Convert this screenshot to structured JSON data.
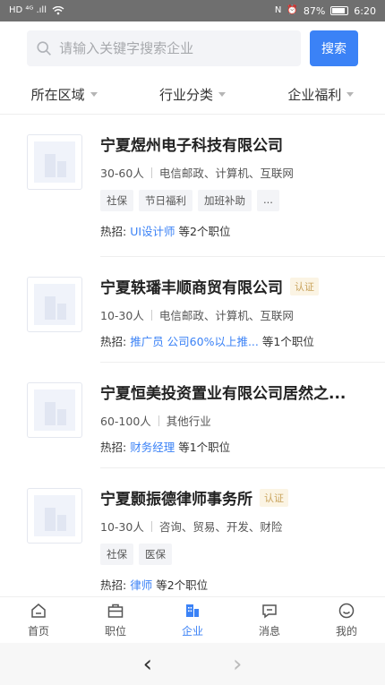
{
  "status_bar": {
    "left": "HD ⁴ᴳ .ıll",
    "nfc": "N",
    "alarm": "⏰",
    "battery": "87%",
    "time": "6:20"
  },
  "search": {
    "placeholder": "请输入关键字搜索企业",
    "button": "搜索"
  },
  "filters": [
    "所在区域",
    "行业分类",
    "企业福利"
  ],
  "companies": [
    {
      "name": "宁夏煜州电子科技有限公司",
      "verified": "",
      "size": "30-60人",
      "industry": "电信邮政、计算机、互联网",
      "tags": [
        "社保",
        "节日福利",
        "加班补助",
        "..."
      ],
      "hot_label": "热招:",
      "hot_job": "UI设计师",
      "hot_count": "等2个职位"
    },
    {
      "name": "宁夏轶璠丰顺商贸有限公司",
      "verified": "认证",
      "size": "10-30人",
      "industry": "电信邮政、计算机、互联网",
      "tags": [],
      "hot_label": "热招:",
      "hot_job": "推广员 公司60%以上推...",
      "hot_count": "等1个职位"
    },
    {
      "name": "宁夏恒美投资置业有限公司居然之...",
      "verified": "",
      "size": "60-100人",
      "industry": "其他行业",
      "tags": [],
      "hot_label": "热招:",
      "hot_job": "财务经理",
      "hot_count": "等1个职位"
    },
    {
      "name": "宁夏颢振德律师事务所",
      "verified": "认证",
      "size": "10-30人",
      "industry": "咨询、贸易、开发、财险",
      "tags": [
        "社保",
        "医保"
      ],
      "hot_label": "热招:",
      "hot_job": "律师",
      "hot_count": "等2个职位"
    }
  ],
  "tabs": [
    {
      "label": "首页",
      "icon": "home-icon",
      "active": false
    },
    {
      "label": "职位",
      "icon": "briefcase-icon",
      "active": false
    },
    {
      "label": "企业",
      "icon": "building-icon",
      "active": true
    },
    {
      "label": "消息",
      "icon": "message-icon",
      "active": false
    },
    {
      "label": "我的",
      "icon": "profile-icon",
      "active": false
    }
  ],
  "system_nav": {
    "back": "‹",
    "forward": "›"
  },
  "colors": {
    "accent": "#3b82f6",
    "verified": "#c9a35c"
  }
}
